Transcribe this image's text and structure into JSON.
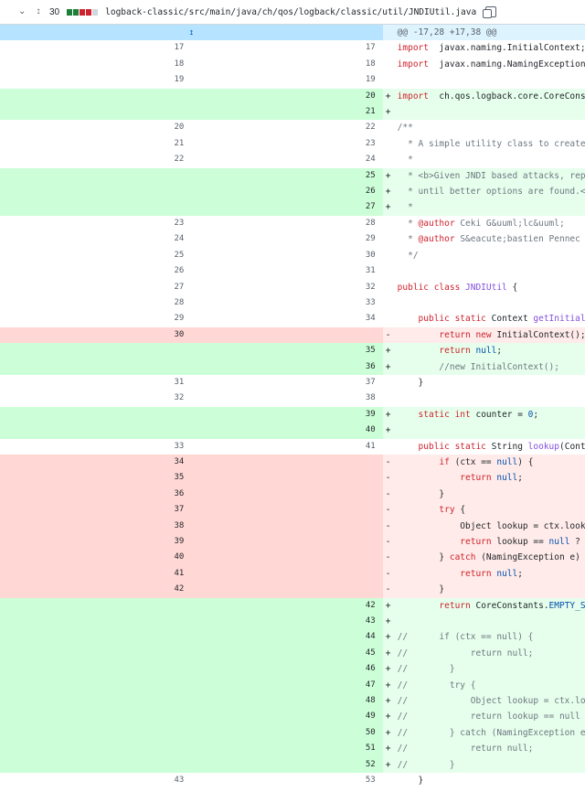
{
  "file": {
    "change_count": "30",
    "bar_colors": [
      "#1a7f37",
      "#1a7f37",
      "#cf222e",
      "#cf222e",
      "#d0d7de"
    ],
    "path": "logback-classic/src/main/java/ch/qos/logback/classic/util/JNDIUtil.java",
    "icons": {
      "collapse": "chevron-down-icon",
      "expand_all": "unfold-icon",
      "copy": "copy-icon"
    }
  },
  "hunk": {
    "header": "@@ -17,28 +17,38 @@",
    "expand_icon": "expand-up-icon"
  },
  "lines": [
    {
      "t": "ctx",
      "o": "17",
      "n": "17",
      "s": "",
      "c": [
        [
          "kw",
          "import"
        ],
        [
          "",
          "  javax.naming.InitialContext;"
        ]
      ]
    },
    {
      "t": "ctx",
      "o": "18",
      "n": "18",
      "s": "",
      "c": [
        [
          "kw",
          "import"
        ],
        [
          "",
          "  javax.naming.NamingException;"
        ]
      ]
    },
    {
      "t": "ctx",
      "o": "19",
      "n": "19",
      "s": "",
      "c": []
    },
    {
      "t": "add",
      "o": "",
      "n": "20",
      "s": "+",
      "c": [
        [
          "kw",
          "import"
        ],
        [
          "",
          "  ch.qos.logback.core.CoreConstants;"
        ]
      ]
    },
    {
      "t": "add",
      "o": "",
      "n": "21",
      "s": "+",
      "c": []
    },
    {
      "t": "ctx",
      "o": "20",
      "n": "22",
      "s": "",
      "c": [
        [
          "cm",
          "/**"
        ]
      ]
    },
    {
      "t": "ctx",
      "o": "21",
      "n": "23",
      "s": "",
      "c": [
        [
          "cm",
          "  * A simple utility class to create and use a JNDI Context."
        ]
      ]
    },
    {
      "t": "ctx",
      "o": "22",
      "n": "24",
      "s": "",
      "c": [
        [
          "cm",
          "  *"
        ]
      ]
    },
    {
      "t": "add",
      "o": "",
      "n": "25",
      "s": "+",
      "c": [
        [
          "cm",
          "  * <b>Given JNDI based attacks, replaced with emtpy code returning null or \"\""
        ]
      ]
    },
    {
      "t": "add",
      "o": "",
      "n": "26",
      "s": "+",
      "c": [
        [
          "cm",
          "  * until better options are found.</b>"
        ]
      ]
    },
    {
      "t": "add",
      "o": "",
      "n": "27",
      "s": "+",
      "c": [
        [
          "cm",
          "  *"
        ]
      ]
    },
    {
      "t": "ctx",
      "o": "23",
      "n": "28",
      "s": "",
      "c": [
        [
          "cm",
          "  * "
        ],
        [
          "kw",
          "@author"
        ],
        [
          "cm",
          " Ceki G&uuml;lc&uuml;"
        ]
      ]
    },
    {
      "t": "ctx",
      "o": "24",
      "n": "29",
      "s": "",
      "c": [
        [
          "cm",
          "  * "
        ],
        [
          "kw",
          "@author"
        ],
        [
          "cm",
          " S&eacute;bastien Pennec"
        ]
      ]
    },
    {
      "t": "ctx",
      "o": "25",
      "n": "30",
      "s": "",
      "c": [
        [
          "cm",
          "  */"
        ]
      ]
    },
    {
      "t": "ctx",
      "o": "26",
      "n": "31",
      "s": "",
      "c": []
    },
    {
      "t": "ctx",
      "o": "27",
      "n": "32",
      "s": "",
      "c": [
        [
          "kw",
          "public class "
        ],
        [
          "fn",
          "JNDIUtil"
        ],
        [
          "",
          " {"
        ]
      ]
    },
    {
      "t": "ctx",
      "o": "28",
      "n": "33",
      "s": "",
      "c": []
    },
    {
      "t": "ctx",
      "o": "29",
      "n": "34",
      "s": "",
      "c": [
        [
          "",
          "    "
        ],
        [
          "kw",
          "public static "
        ],
        [
          "",
          "Context "
        ],
        [
          "fn",
          "getInitialContext"
        ],
        [
          "",
          "() "
        ],
        [
          "kw",
          "throws"
        ],
        [
          "",
          " NamingException {"
        ]
      ]
    },
    {
      "t": "del",
      "o": "30",
      "n": "",
      "s": "-",
      "c": [
        [
          "",
          "        "
        ],
        [
          "kw",
          "return new "
        ],
        [
          "",
          "InitialContext();"
        ]
      ]
    },
    {
      "t": "add",
      "o": "",
      "n": "35",
      "s": "+",
      "c": [
        [
          "",
          "        "
        ],
        [
          "kw",
          "return "
        ],
        [
          "cn",
          "null"
        ],
        [
          "",
          ";"
        ]
      ]
    },
    {
      "t": "add",
      "o": "",
      "n": "36",
      "s": "+",
      "c": [
        [
          "",
          "        "
        ],
        [
          "cm",
          "//new InitialContext();"
        ]
      ]
    },
    {
      "t": "ctx",
      "o": "31",
      "n": "37",
      "s": "",
      "c": [
        [
          "",
          "    }"
        ]
      ]
    },
    {
      "t": "ctx",
      "o": "32",
      "n": "38",
      "s": "",
      "c": []
    },
    {
      "t": "add",
      "o": "",
      "n": "39",
      "s": "+",
      "c": [
        [
          "",
          "    "
        ],
        [
          "kw",
          "static int "
        ],
        [
          "",
          "counter = "
        ],
        [
          "cn",
          "0"
        ],
        [
          "",
          ";"
        ]
      ]
    },
    {
      "t": "add",
      "o": "",
      "n": "40",
      "s": "+",
      "c": []
    },
    {
      "t": "ctx",
      "o": "33",
      "n": "41",
      "s": "",
      "c": [
        [
          "",
          "    "
        ],
        [
          "kw",
          "public static "
        ],
        [
          "",
          "String "
        ],
        [
          "fn",
          "lookup"
        ],
        [
          "",
          "(Context ctx, String name) {"
        ]
      ]
    },
    {
      "t": "del",
      "o": "34",
      "n": "",
      "s": "-",
      "c": [
        [
          "",
          "        "
        ],
        [
          "kw",
          "if "
        ],
        [
          "",
          "(ctx == "
        ],
        [
          "cn",
          "null"
        ],
        [
          "",
          ") {"
        ]
      ]
    },
    {
      "t": "del",
      "o": "35",
      "n": "",
      "s": "-",
      "c": [
        [
          "",
          "            "
        ],
        [
          "kw",
          "return "
        ],
        [
          "cn",
          "null"
        ],
        [
          "",
          ";"
        ]
      ]
    },
    {
      "t": "del",
      "o": "36",
      "n": "",
      "s": "-",
      "c": [
        [
          "",
          "        }"
        ]
      ]
    },
    {
      "t": "del",
      "o": "37",
      "n": "",
      "s": "-",
      "c": [
        [
          "",
          "        "
        ],
        [
          "kw",
          "try"
        ],
        [
          "",
          " {"
        ]
      ]
    },
    {
      "t": "del",
      "o": "38",
      "n": "",
      "s": "-",
      "c": [
        [
          "",
          "            Object lookup = ctx.lookup(name);"
        ]
      ]
    },
    {
      "t": "del",
      "o": "39",
      "n": "",
      "s": "-",
      "c": [
        [
          "",
          "            "
        ],
        [
          "kw",
          "return "
        ],
        [
          "",
          "lookup == "
        ],
        [
          "cn",
          "null"
        ],
        [
          "",
          " ? "
        ],
        [
          "cn",
          "null"
        ],
        [
          "",
          " : lookup.toString();"
        ]
      ]
    },
    {
      "t": "del",
      "o": "40",
      "n": "",
      "s": "-",
      "c": [
        [
          "",
          "        } "
        ],
        [
          "kw",
          "catch"
        ],
        [
          "",
          " (NamingException e) {"
        ]
      ]
    },
    {
      "t": "del",
      "o": "41",
      "n": "",
      "s": "-",
      "c": [
        [
          "",
          "            "
        ],
        [
          "kw",
          "return "
        ],
        [
          "cn",
          "null"
        ],
        [
          "",
          ";"
        ]
      ]
    },
    {
      "t": "del",
      "o": "42",
      "n": "",
      "s": "-",
      "c": [
        [
          "",
          "        }"
        ]
      ]
    },
    {
      "t": "add",
      "o": "",
      "n": "42",
      "s": "+",
      "c": [
        [
          "",
          "        "
        ],
        [
          "kw",
          "return "
        ],
        [
          "",
          "CoreConstants."
        ],
        [
          "cn",
          "EMPTY_STRING"
        ],
        [
          "",
          ";"
        ]
      ]
    },
    {
      "t": "add",
      "o": "",
      "n": "43",
      "s": "+",
      "c": []
    },
    {
      "t": "add",
      "o": "",
      "n": "44",
      "s": "+",
      "c": [
        [
          "cm",
          "//      if (ctx == null) {"
        ]
      ]
    },
    {
      "t": "add",
      "o": "",
      "n": "45",
      "s": "+",
      "c": [
        [
          "cm",
          "//            return null;"
        ]
      ]
    },
    {
      "t": "add",
      "o": "",
      "n": "46",
      "s": "+",
      "c": [
        [
          "cm",
          "//        }"
        ]
      ]
    },
    {
      "t": "add",
      "o": "",
      "n": "47",
      "s": "+",
      "c": [
        [
          "cm",
          "//        try {"
        ]
      ]
    },
    {
      "t": "add",
      "o": "",
      "n": "48",
      "s": "+",
      "c": [
        [
          "cm",
          "//            Object lookup = ctx.lookup(name);"
        ]
      ]
    },
    {
      "t": "add",
      "o": "",
      "n": "49",
      "s": "+",
      "c": [
        [
          "cm",
          "//            return lookup == null ? null : lookup.toString();"
        ]
      ]
    },
    {
      "t": "add",
      "o": "",
      "n": "50",
      "s": "+",
      "c": [
        [
          "cm",
          "//        } catch (NamingException e) {"
        ]
      ]
    },
    {
      "t": "add",
      "o": "",
      "n": "51",
      "s": "+",
      "c": [
        [
          "cm",
          "//            return null;"
        ]
      ]
    },
    {
      "t": "add",
      "o": "",
      "n": "52",
      "s": "+",
      "c": [
        [
          "cm",
          "//        }"
        ]
      ]
    },
    {
      "t": "ctx",
      "o": "43",
      "n": "53",
      "s": "",
      "c": [
        [
          "",
          "    }"
        ]
      ]
    }
  ]
}
